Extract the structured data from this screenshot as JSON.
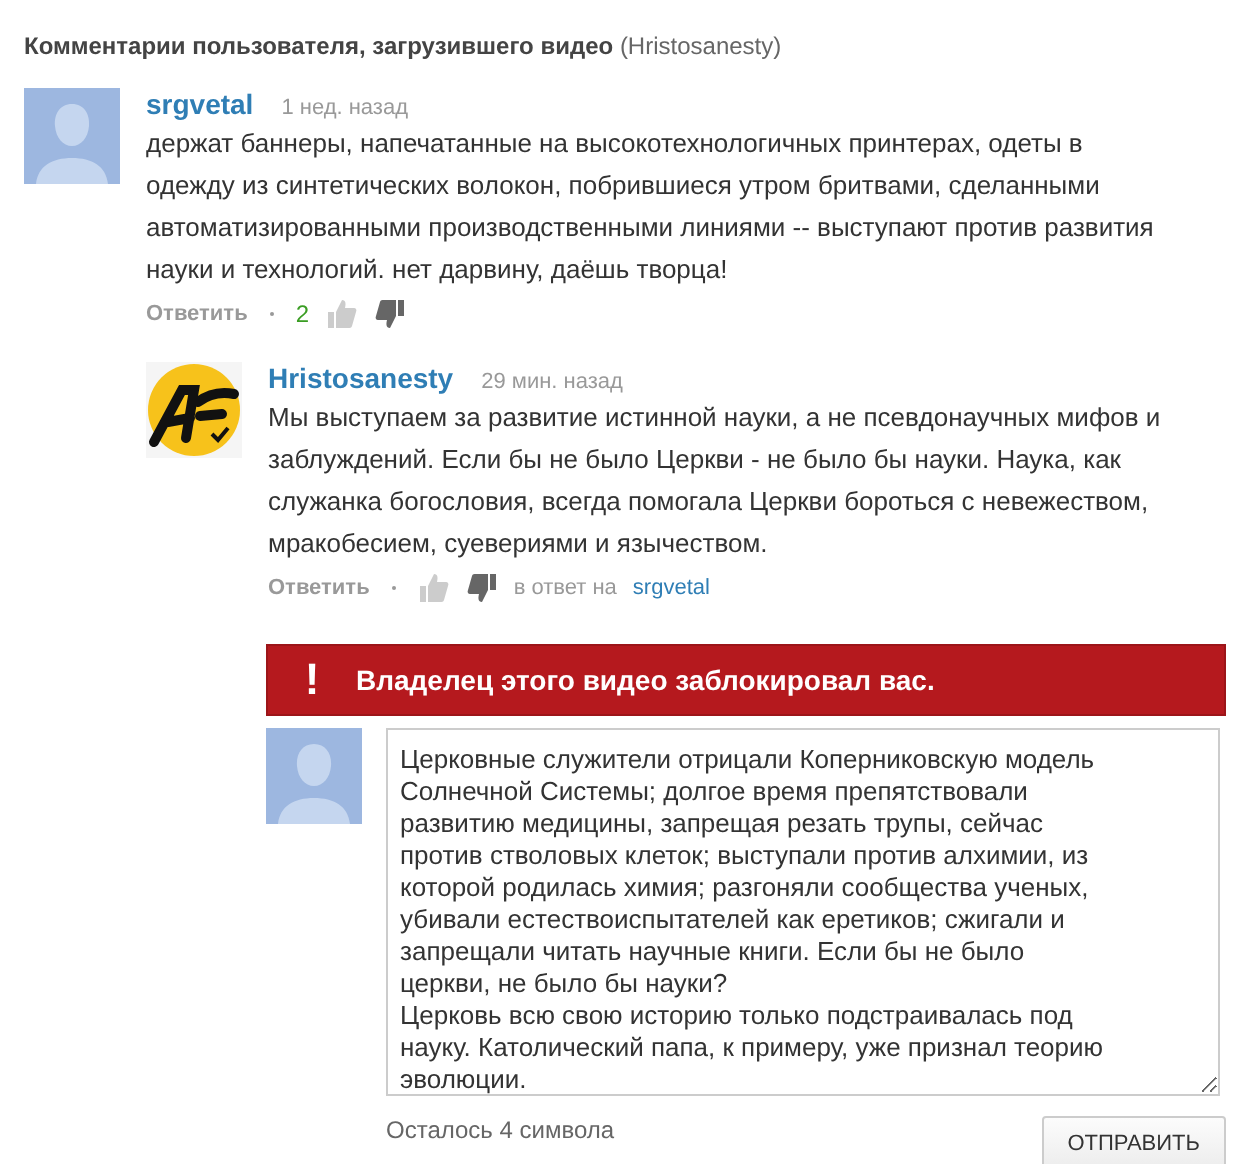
{
  "header": {
    "title": "Комментарии пользователя, загрузившего видео",
    "uploader": "(Hristosanesty)"
  },
  "comments": [
    {
      "author": "srgvetal",
      "time": "1 нед. назад",
      "avatar": {
        "kind": "silhouette"
      },
      "text": "держат баннеры, напечатанные на высокотехнологичных принтерах, одеты в одежду из синтетических волокон, побрившиеся утром бритвами, сделанными автоматизированными производственными линиями -- выступают против развития науки и технологий. нет дарвину, даёшь творца!",
      "reply": "Ответить",
      "likes": "2",
      "replies": [
        {
          "author": "Hristosanesty",
          "time": "29 мин. назад",
          "avatar": {
            "kind": "logo"
          },
          "text": "Мы выступаем за развитие истинной науки, а не псевдонаучных мифов и заблуждений. Если бы не было Церкви - не было бы науки. Наука, как служанка богословия, всегда помогала Церкви бороться с невежеством, мракобесием, суевериями и язычеством.",
          "reply": "Ответить",
          "in_reply_prefix": "в ответ на",
          "in_reply_user": "srgvetal"
        }
      ]
    }
  ],
  "blocked_banner": {
    "icon": "!",
    "text": "Владелец этого видео заблокировал вас."
  },
  "compose": {
    "value": "Церковные служители отрицали Коперниковскую модель Солнечной Системы; долгое время препятствовали развитию медицины, запрещая резать трупы, сейчас против стволовых клеток; выступали против алхимии, из которой родилась химия; разгоняли сообщества ученых, убивали естествоиспытателей как еретиков; сжигали и запрещали читать научные книги. Если бы не было церкви, не было бы науки?\nЦерковь всю свою историю только подстраивалась под науку. Католический папа, к примеру, уже признал теорию эволюции.",
    "remaining": "Осталось 4 символа",
    "submit": "ОТПРАВИТЬ"
  }
}
